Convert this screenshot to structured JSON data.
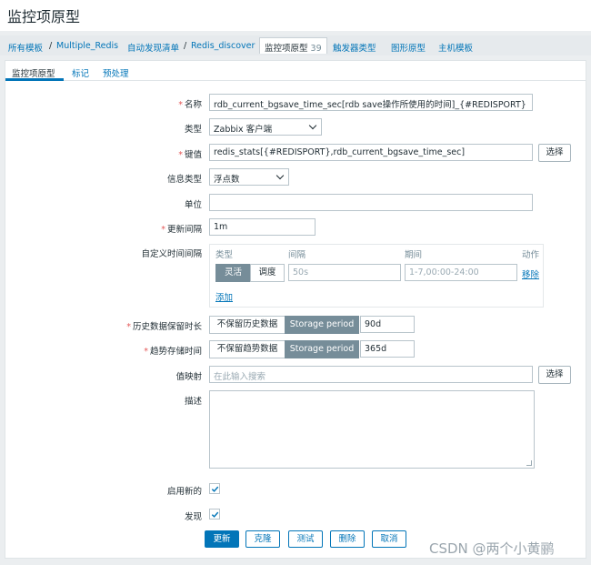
{
  "page_title": "监控项原型",
  "breadcrumb": {
    "items": [
      "所有模板",
      "Multiple_Redis",
      "自动发现清单",
      "Redis_discover"
    ],
    "separator": "/",
    "active": {
      "label": "监控项原型",
      "count": "39"
    },
    "links": [
      "触发器类型",
      "图形原型",
      "主机模板"
    ]
  },
  "tabs": [
    "监控项原型",
    "标记",
    "预处理"
  ],
  "form": {
    "name": {
      "label": "名称",
      "value": "rdb_current_bgsave_time_sec[rdb save操作所使用的时间]_{#REDISPORT}"
    },
    "type": {
      "label": "类型",
      "value": "Zabbix 客户端"
    },
    "key": {
      "label": "键值",
      "value": "redis_stats[{#REDISPORT},rdb_current_bgsave_time_sec]",
      "button": "选择"
    },
    "info_type": {
      "label": "信息类型",
      "value": "浮点数"
    },
    "unit": {
      "label": "单位",
      "value": ""
    },
    "update_interval": {
      "label": "更新间隔",
      "value": "1m"
    },
    "custom_intervals": {
      "label": "自定义时间间隔",
      "col_type": "类型",
      "col_interval": "间隔",
      "col_period": "期间",
      "col_action": "动作",
      "row": {
        "flexible": "灵活",
        "scheduling": "调度",
        "interval_placeholder": "50s",
        "period_placeholder": "1-7,00:00-24:00",
        "remove": "移除"
      },
      "add": "添加"
    },
    "history": {
      "label": "历史数据保留时长",
      "option_off": "不保留历史数据",
      "option_on": "Storage period",
      "value": "90d"
    },
    "trends": {
      "label": "趋势存储时间",
      "option_off": "不保留趋势数据",
      "option_on": "Storage period",
      "value": "365d"
    },
    "valuemap": {
      "label": "值映射",
      "placeholder": "在此输入搜索",
      "button": "选择"
    },
    "description": {
      "label": "描述"
    },
    "create_enabled": {
      "label": "启用新的"
    },
    "discover": {
      "label": "发现"
    }
  },
  "buttons": {
    "update": "更新",
    "clone": "克隆",
    "test": "测试",
    "delete": "删除",
    "cancel": "取消"
  },
  "watermark": "CSDN @两个小黄鹂",
  "colors": {
    "accent": "#0275b8",
    "required": "#e45959",
    "segment_on": "#768d99"
  }
}
